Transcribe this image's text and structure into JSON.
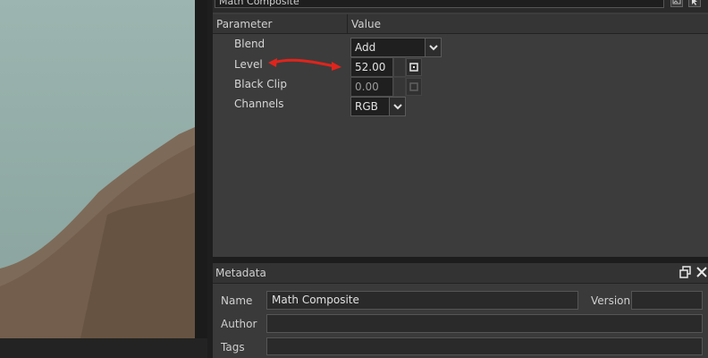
{
  "composite": {
    "name": "Math Composite"
  },
  "parameters": {
    "header": {
      "parameter": "Parameter",
      "value": "Value"
    },
    "rows": [
      {
        "label": "Blend",
        "value": "Add"
      },
      {
        "label": "Level",
        "value": "52.00"
      },
      {
        "label": "Black Clip",
        "value": "0.00"
      },
      {
        "label": "Channels",
        "value": "RGB"
      }
    ]
  },
  "annotation": {
    "color": "#e0241c"
  },
  "metadata": {
    "title": "Metadata",
    "name_label": "Name",
    "name_value": "Math Composite",
    "version_label": "Version",
    "version_value": "",
    "author_label": "Author",
    "author_value": "",
    "tags_label": "Tags",
    "tags_value": ""
  },
  "icons": [
    "image-icon",
    "cursor-tool-icon",
    "chevron-down-icon",
    "keyframe-icon",
    "restore-window-icon",
    "close-icon"
  ]
}
